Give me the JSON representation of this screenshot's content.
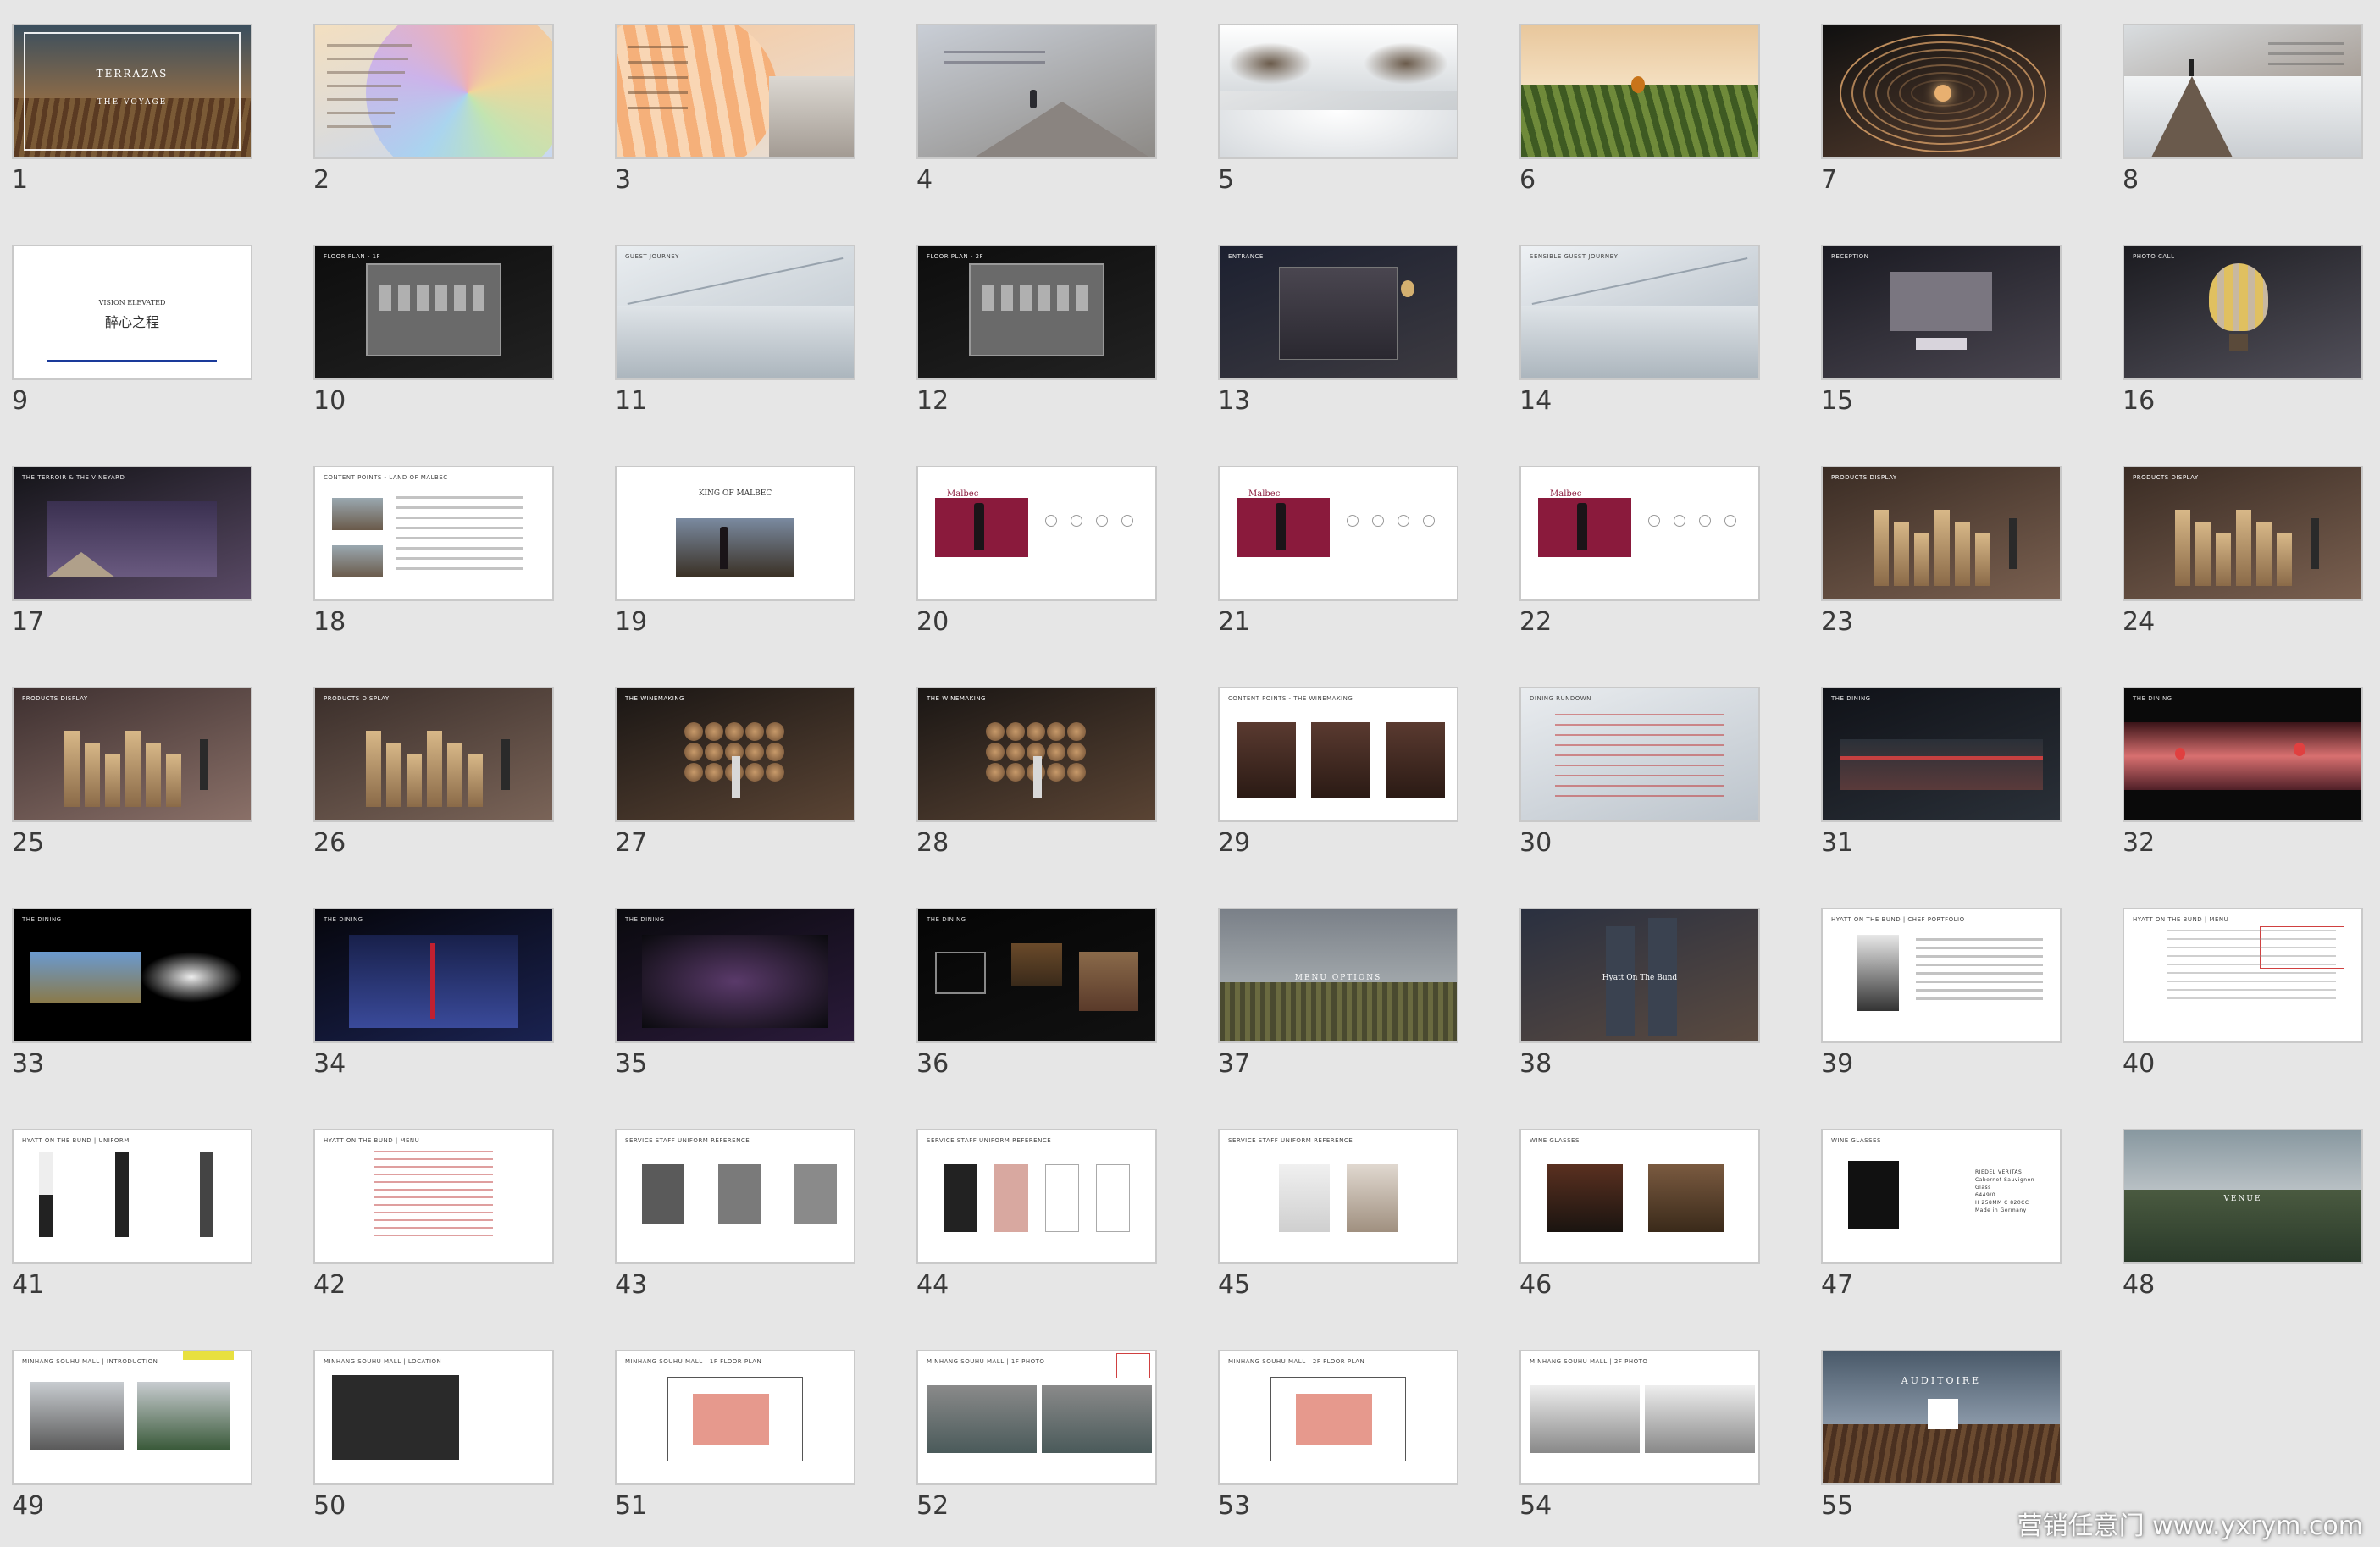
{
  "watermark": "营销任意门 www.yxrym.com",
  "slides": [
    {
      "num": "1",
      "style": "hero",
      "bg": [
        "#2c3a44",
        "#6a4a2e"
      ],
      "title": "TERRAZAS",
      "sub": "THE VOYAGE"
    },
    {
      "num": "2",
      "style": "rainbow",
      "bg": [
        "#f3dfc0",
        "#c8d8f0"
      ],
      "title": ""
    },
    {
      "num": "3",
      "style": "balloon",
      "bg": [
        "#f6c9a0",
        "#e7e0d8"
      ],
      "title": ""
    },
    {
      "num": "4",
      "style": "mountain",
      "bg": [
        "#c9ced6",
        "#8d8a86"
      ],
      "title": ""
    },
    {
      "num": "5",
      "style": "clouds",
      "bg": [
        "#f2f2f2",
        "#bfc4c8"
      ],
      "title": ""
    },
    {
      "num": "6",
      "style": "vineyard",
      "bg": [
        "#e6c59a",
        "#4f6b2c"
      ],
      "title": ""
    },
    {
      "num": "7",
      "style": "tunnel",
      "bg": [
        "#101010",
        "#5a4030"
      ],
      "title": ""
    },
    {
      "num": "8",
      "style": "peak",
      "bg": [
        "#d9dde0",
        "#8a7a6c"
      ],
      "title": ""
    },
    {
      "num": "9",
      "style": "white",
      "bg": [
        "#ffffff",
        "#ffffff"
      ],
      "title": "醉心之程",
      "sub": "VISION ELEVATED"
    },
    {
      "num": "10",
      "style": "plan-dark",
      "bg": [
        "#0d0d0d",
        "#222222"
      ],
      "title": "FLOOR PLAN - 1F"
    },
    {
      "num": "11",
      "style": "snowmap",
      "bg": [
        "#e9edf0",
        "#b9c2ca"
      ],
      "title": "GUEST JOURNEY"
    },
    {
      "num": "12",
      "style": "plan-dark",
      "bg": [
        "#0d0d0d",
        "#222222"
      ],
      "title": "FLOOR PLAN - 2F"
    },
    {
      "num": "13",
      "style": "building",
      "bg": [
        "#1c2030",
        "#3c3a40"
      ],
      "title": "ENTRANCE"
    },
    {
      "num": "14",
      "style": "snowmap",
      "bg": [
        "#eef1f4",
        "#a9b4be"
      ],
      "title": "SENSIBLE GUEST JOURNEY"
    },
    {
      "num": "15",
      "style": "hall",
      "bg": [
        "#1a1a22",
        "#4a4650"
      ],
      "title": "RECEPTION"
    },
    {
      "num": "16",
      "style": "balloonhall",
      "bg": [
        "#1b1b20",
        "#52505a"
      ],
      "title": "PHOTO CALL"
    },
    {
      "num": "17",
      "style": "stage",
      "bg": [
        "#141418",
        "#5a4a66"
      ],
      "title": "THE TERROIR & THE VINEYARD"
    },
    {
      "num": "18",
      "style": "textdoc",
      "bg": [
        "#ffffff",
        "#ffffff"
      ],
      "title": "CONTENT POINTS - LAND OF MALBEC"
    },
    {
      "num": "19",
      "style": "wineposter",
      "bg": [
        "#ffffff",
        "#ffffff"
      ],
      "title": "KING OF MALBEC"
    },
    {
      "num": "20",
      "style": "malbec",
      "bg": [
        "#ffffff",
        "#ffffff"
      ],
      "title": "Malbec"
    },
    {
      "num": "21",
      "style": "malbec",
      "bg": [
        "#ffffff",
        "#ffffff"
      ],
      "title": "Malbec"
    },
    {
      "num": "22",
      "style": "malbec",
      "bg": [
        "#ffffff",
        "#ffffff"
      ],
      "title": "Malbec"
    },
    {
      "num": "23",
      "style": "pillars",
      "bg": [
        "#3a2c24",
        "#7a6050"
      ],
      "title": "PRODUCTS DISPLAY"
    },
    {
      "num": "24",
      "style": "pillars",
      "bg": [
        "#3a2c24",
        "#7a6050"
      ],
      "title": "PRODUCTS DISPLAY"
    },
    {
      "num": "25",
      "style": "pillars",
      "bg": [
        "#3e3030",
        "#8a7068"
      ],
      "title": "PRODUCTS DISPLAY"
    },
    {
      "num": "26",
      "style": "pillars",
      "bg": [
        "#3a2e2a",
        "#7a6458"
      ],
      "title": "PRODUCTS DISPLAY"
    },
    {
      "num": "27",
      "style": "barrels",
      "bg": [
        "#1a1614",
        "#5a4434"
      ],
      "title": "THE WINEMAKING"
    },
    {
      "num": "28",
      "style": "barrels",
      "bg": [
        "#1a1614",
        "#5a4434"
      ],
      "title": "THE WINEMAKING"
    },
    {
      "num": "29",
      "style": "photos3",
      "bg": [
        "#ffffff",
        "#ffffff"
      ],
      "title": "CONTENT POINTS - THE WINEMAKING"
    },
    {
      "num": "30",
      "style": "schedule",
      "bg": [
        "#e9ecef",
        "#bcc4cc"
      ],
      "title": "DINING RUNDOWN"
    },
    {
      "num": "31",
      "style": "banquet",
      "bg": [
        "#101218",
        "#2a3038"
      ],
      "title": "THE DINING"
    },
    {
      "num": "32",
      "style": "sunsetstrip",
      "bg": [
        "#0a0a0a",
        "#0a0a0a"
      ],
      "title": "THE DINING"
    },
    {
      "num": "33",
      "style": "blackphotos",
      "bg": [
        "#000000",
        "#000000"
      ],
      "title": "THE DINING"
    },
    {
      "num": "34",
      "style": "aerial",
      "bg": [
        "#06060c",
        "#1a2250"
      ],
      "title": "THE DINING"
    },
    {
      "num": "35",
      "style": "band",
      "bg": [
        "#0a0a0e",
        "#2a1a3a"
      ],
      "title": "THE DINING"
    },
    {
      "num": "36",
      "style": "food",
      "bg": [
        "#050505",
        "#111111"
      ],
      "title": "THE DINING"
    },
    {
      "num": "37",
      "style": "menu",
      "bg": [
        "#555a60",
        "#2a2c22"
      ],
      "title": "MENU OPTIONS"
    },
    {
      "num": "38",
      "style": "hotel",
      "bg": [
        "#2a3040",
        "#5a4a40"
      ],
      "title": "Hyatt On The Bund"
    },
    {
      "num": "39",
      "style": "chef",
      "bg": [
        "#ffffff",
        "#ffffff"
      ],
      "title": "HYATT ON THE BUND | CHEF PORTFOLIO"
    },
    {
      "num": "40",
      "style": "menutext",
      "bg": [
        "#ffffff",
        "#ffffff"
      ],
      "title": "HYATT ON THE BUND | MENU"
    },
    {
      "num": "41",
      "style": "waiters",
      "bg": [
        "#ffffff",
        "#ffffff"
      ],
      "title": "HYATT ON THE BUND | UNIFORM"
    },
    {
      "num": "42",
      "style": "menutext2",
      "bg": [
        "#ffffff",
        "#ffffff"
      ],
      "title": "HYATT ON THE BUND | MENU"
    },
    {
      "num": "43",
      "style": "vests",
      "bg": [
        "#ffffff",
        "#ffffff"
      ],
      "title": "SERVICE STAFF UNIFORM REFERENCE"
    },
    {
      "num": "44",
      "style": "aprons",
      "bg": [
        "#ffffff",
        "#ffffff"
      ],
      "title": "SERVICE STAFF UNIFORM REFERENCE"
    },
    {
      "num": "45",
      "style": "scarves",
      "bg": [
        "#ffffff",
        "#ffffff"
      ],
      "title": "SERVICE STAFF UNIFORM REFERENCE"
    },
    {
      "num": "46",
      "style": "glasses",
      "bg": [
        "#ffffff",
        "#ffffff"
      ],
      "title": "WINE GLASSES"
    },
    {
      "num": "47",
      "style": "glassspec",
      "bg": [
        "#ffffff",
        "#ffffff"
      ],
      "title": "WINE GLASSES",
      "lines": [
        "RIEDEL VERITAS",
        "Cabernet Sauvignon",
        "Glass",
        "6449/0",
        "H 258MM C 820CC",
        "Made in Germany"
      ]
    },
    {
      "num": "48",
      "style": "venue",
      "bg": [
        "#7a8890",
        "#3a4a3a"
      ],
      "title": "VENUE"
    },
    {
      "num": "49",
      "style": "building2",
      "bg": [
        "#ffffff",
        "#ffffff"
      ],
      "title": "MINHANG SOUHU MALL | INTRODUCTION"
    },
    {
      "num": "50",
      "style": "citymap",
      "bg": [
        "#ffffff",
        "#ffffff"
      ],
      "title": "MINHANG SOUHU MALL | LOCATION"
    },
    {
      "num": "51",
      "style": "floorplan",
      "bg": [
        "#ffffff",
        "#ffffff"
      ],
      "title": "MINHANG SOUHU MALL | 1F FLOOR PLAN"
    },
    {
      "num": "52",
      "style": "warehouse",
      "bg": [
        "#ffffff",
        "#ffffff"
      ],
      "title": "MINHANG SOUHU MALL | 1F PHOTO"
    },
    {
      "num": "53",
      "style": "floorplan",
      "bg": [
        "#ffffff",
        "#ffffff"
      ],
      "title": "MINHANG SOUHU MALL | 2F FLOOR PLAN"
    },
    {
      "num": "54",
      "style": "warehouse2",
      "bg": [
        "#ffffff",
        "#ffffff"
      ],
      "title": "MINHANG SOUHU MALL | 2F PHOTO"
    },
    {
      "num": "55",
      "style": "auditoire",
      "bg": [
        "#3a4a5a",
        "#3a2a1a"
      ],
      "title": "AUDITOIRE"
    }
  ]
}
